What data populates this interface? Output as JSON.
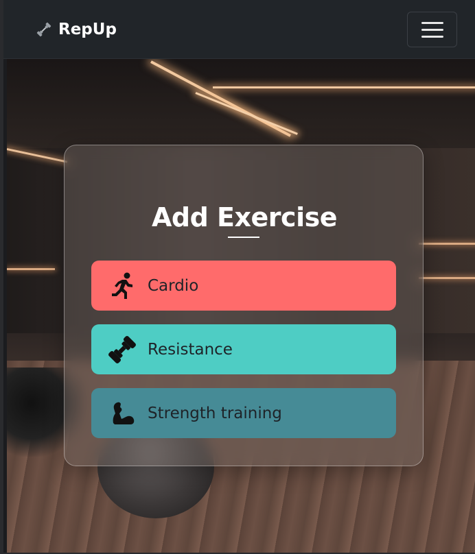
{
  "navbar": {
    "brand": "RepUp",
    "brand_icon": "dumbbell-icon",
    "menu_icon": "hamburger-menu-icon",
    "background": "#212529"
  },
  "card": {
    "title": "Add Exercise",
    "options": [
      {
        "label": "Cardio",
        "icon": "running-person-icon",
        "color": "#ff6b6b"
      },
      {
        "label": "Resistance",
        "icon": "dumbbell-icon",
        "color": "#4ecdc4"
      },
      {
        "label": "Strength training",
        "icon": "flexed-bicep-icon",
        "color": "#468b96"
      }
    ]
  }
}
